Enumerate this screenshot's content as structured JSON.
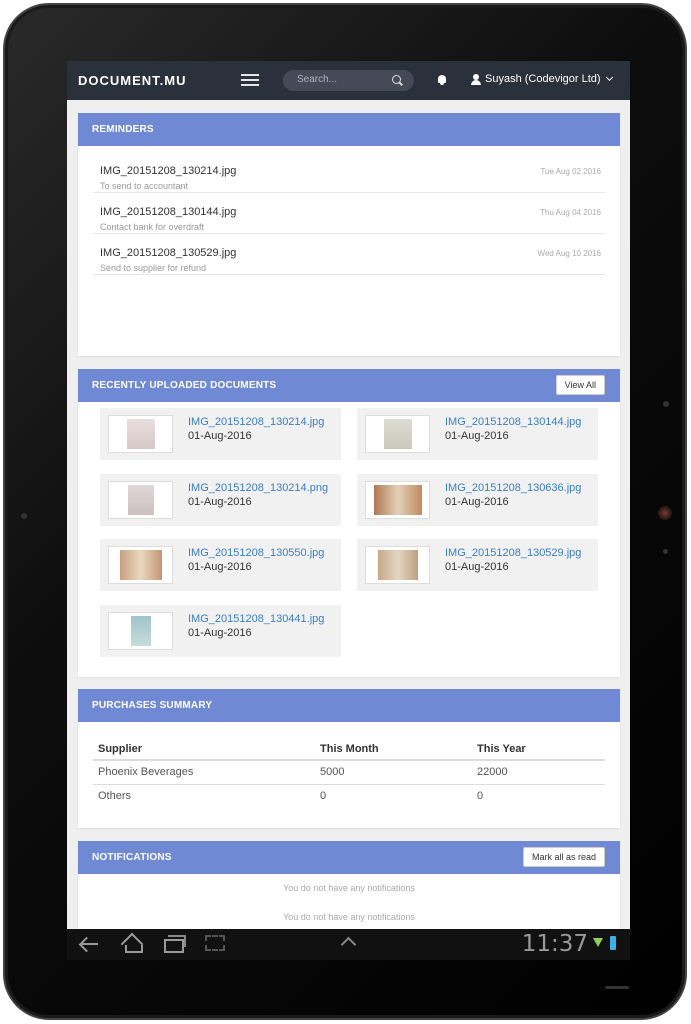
{
  "topnav": {
    "brand": "DOCUMENT.MU",
    "search_placeholder": "Search...",
    "user_name": "Suyash (Codevigor Ltd)"
  },
  "reminders": {
    "title": "REMINDERS",
    "items": [
      {
        "file": "IMG_20151208_130214.jpg",
        "note": "To send to accountant",
        "date": "Tue Aug 02 2016"
      },
      {
        "file": "IMG_20151208_130144.jpg",
        "note": "Contact bank for overdraft",
        "date": "Thu Aug 04 2016"
      },
      {
        "file": "IMG_20151208_130529.jpg",
        "note": "Send to supplier for refund",
        "date": "Wed Aug 10 2016"
      }
    ]
  },
  "recent": {
    "title": "RECENTLY UPLOADED DOCUMENTS",
    "view_all": "View All",
    "docs": [
      {
        "name": "IMG_20151208_130214.jpg",
        "date": "01-Aug-2016"
      },
      {
        "name": "IMG_20151208_130144.jpg",
        "date": "01-Aug-2016"
      },
      {
        "name": "IMG_20151208_130214.png",
        "date": "01-Aug-2016"
      },
      {
        "name": "IMG_20151208_130636.jpg",
        "date": "01-Aug-2016"
      },
      {
        "name": "IMG_20151208_130550.jpg",
        "date": "01-Aug-2016"
      },
      {
        "name": "IMG_20151208_130529.jpg",
        "date": "01-Aug-2016"
      },
      {
        "name": "IMG_20151208_130441.jpg",
        "date": "01-Aug-2016"
      }
    ]
  },
  "purchases": {
    "title": "PURCHASES SUMMARY",
    "columns": [
      "Supplier",
      "This Month",
      "This Year"
    ],
    "rows": [
      [
        "Phoenix Beverages",
        "5000",
        "22000"
      ],
      [
        "Others",
        "0",
        "0"
      ]
    ]
  },
  "notifications": {
    "title": "NOTIFICATIONS",
    "mark_all": "Mark all as read",
    "messages": [
      "You do not have any notifications",
      "You do not have any notifications"
    ]
  },
  "system_bar": {
    "clock": "11:37"
  },
  "colors": {
    "panel_header": "#7089d5",
    "topnav": "#2b313b",
    "link": "#3a7ec4"
  }
}
